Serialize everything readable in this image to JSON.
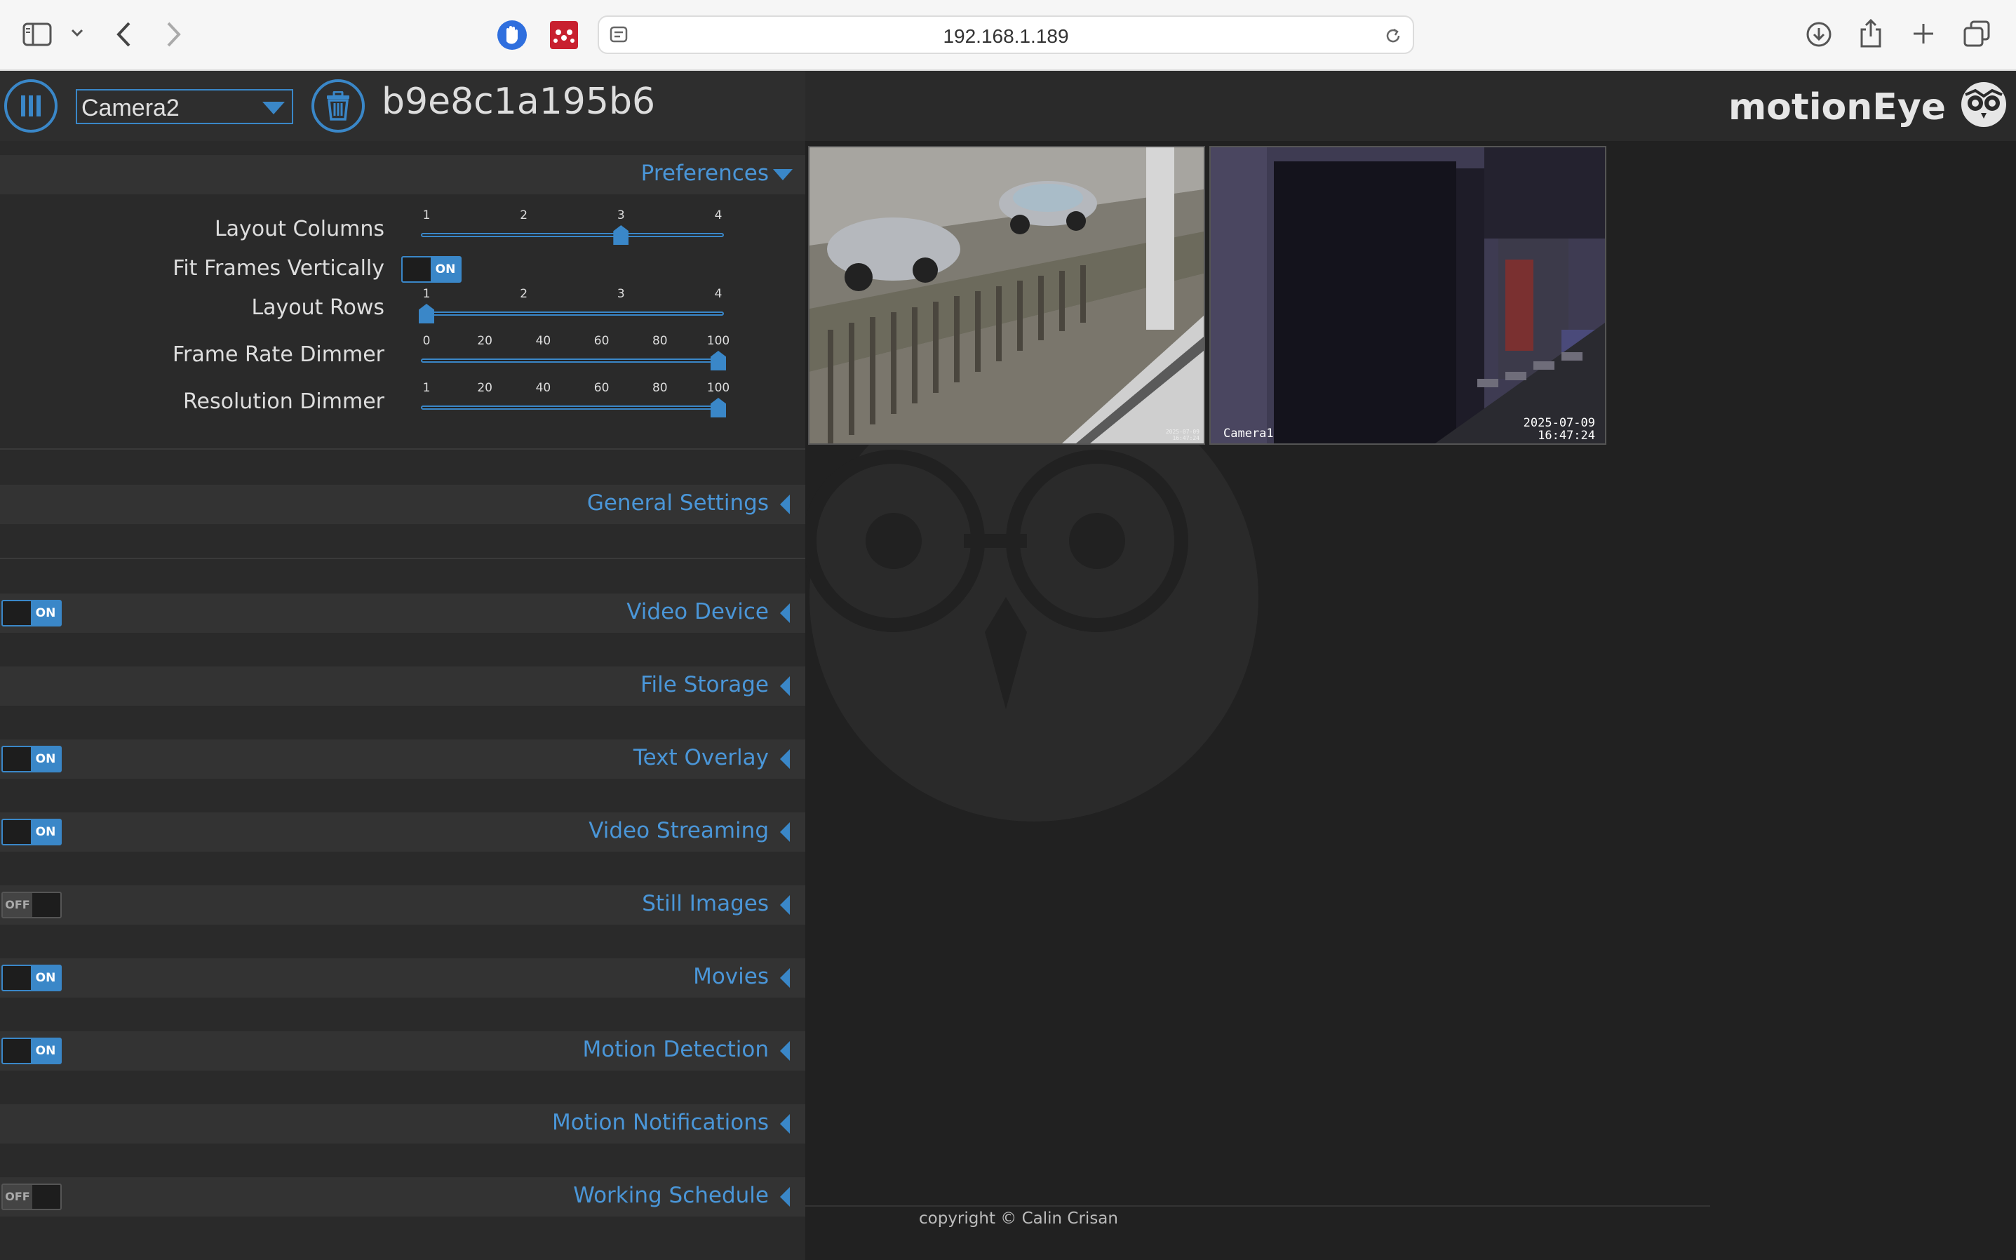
{
  "browser": {
    "url": "192.168.1.189"
  },
  "header": {
    "camera_selected": "Camera2",
    "device_id": "b9e8c1a195b6",
    "brand": "motionEye"
  },
  "preferences": {
    "title": "Preferences",
    "layout_columns": {
      "label": "Layout Columns",
      "ticks": [
        "1",
        "2",
        "3",
        "4"
      ],
      "value": 3,
      "min": 1,
      "max": 4
    },
    "fit_frames": {
      "label": "Fit Frames Vertically",
      "state": "ON"
    },
    "layout_rows": {
      "label": "Layout Rows",
      "ticks": [
        "1",
        "2",
        "3",
        "4"
      ],
      "value": 1,
      "min": 1,
      "max": 4
    },
    "frame_rate_dimmer": {
      "label": "Frame Rate Dimmer",
      "ticks": [
        "0",
        "20",
        "40",
        "60",
        "80",
        "100"
      ],
      "value": 100,
      "min": 0,
      "max": 100
    },
    "resolution_dimmer": {
      "label": "Resolution Dimmer",
      "ticks": [
        "1",
        "20",
        "40",
        "60",
        "80",
        "100"
      ],
      "value": 100,
      "min": 1,
      "max": 100
    }
  },
  "sections": [
    {
      "title": "General Settings",
      "toggle": null
    },
    {
      "title": "Video Device",
      "toggle": "ON"
    },
    {
      "title": "File Storage",
      "toggle": null
    },
    {
      "title": "Text Overlay",
      "toggle": "ON"
    },
    {
      "title": "Video Streaming",
      "toggle": "ON"
    },
    {
      "title": "Still Images",
      "toggle": "OFF"
    },
    {
      "title": "Movies",
      "toggle": "ON"
    },
    {
      "title": "Motion Detection",
      "toggle": "ON"
    },
    {
      "title": "Motion Notifications",
      "toggle": null
    },
    {
      "title": "Working Schedule",
      "toggle": "OFF"
    }
  ],
  "cameras": {
    "camera2": {
      "timestamp_line1": "2025-07-09",
      "timestamp_line2": "16:47:24"
    },
    "camera1": {
      "name": "Camera1",
      "timestamp_line1": "2025-07-09",
      "timestamp_line2": "16:47:24"
    }
  },
  "footer": {
    "copyright": "copyright © Calin Crisan"
  },
  "colors": {
    "accent": "#3a87c8",
    "link": "#4a96d8",
    "panel": "#2a2a2a",
    "background": "#212121"
  },
  "icons": [
    "sidebar-icon",
    "chevron-down-icon",
    "back-icon",
    "forward-icon",
    "hand-stop-icon",
    "mendeley-icon",
    "page-menu-icon",
    "reload-icon",
    "download-icon",
    "share-icon",
    "new-tab-icon",
    "tabs-overview-icon",
    "menu-icon",
    "trash-icon",
    "owl-logo-icon"
  ]
}
